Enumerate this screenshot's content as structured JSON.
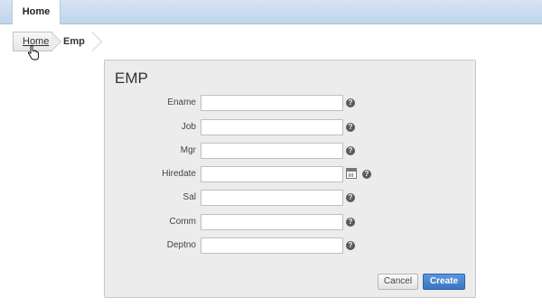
{
  "tabs": {
    "home_label": "Home"
  },
  "breadcrumb": {
    "home": "Home",
    "current": "Emp"
  },
  "region": {
    "title": "EMP",
    "fields": [
      {
        "label": "Ename",
        "value": ""
      },
      {
        "label": "Job",
        "value": ""
      },
      {
        "label": "Mgr",
        "value": ""
      },
      {
        "label": "Hiredate",
        "value": ""
      },
      {
        "label": "Sal",
        "value": ""
      },
      {
        "label": "Comm",
        "value": ""
      },
      {
        "label": "Deptno",
        "value": ""
      }
    ],
    "help_glyph": "?",
    "buttons": {
      "cancel": "Cancel",
      "create": "Create"
    }
  },
  "icons": {
    "help": "help-icon",
    "calendar": "calendar-icon",
    "cursor": "hand-cursor-icon"
  },
  "colors": {
    "topbar": "#c8daf0",
    "create_button": "#3f7bc9",
    "region_bg": "#ececec"
  }
}
